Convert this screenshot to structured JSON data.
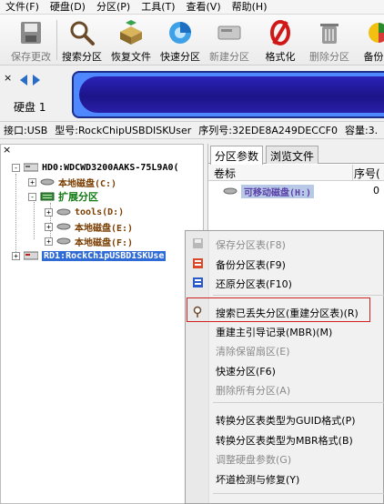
{
  "menu": [
    "文件(F)",
    "硬盘(D)",
    "分区(P)",
    "工具(T)",
    "查看(V)",
    "帮助(H)"
  ],
  "toolbar": {
    "save": "保存更改",
    "search": "搜索分区",
    "recover": "恢复文件",
    "quickpart": "快速分区",
    "newpart": "新建分区",
    "format": "格式化",
    "delete": "删除分区",
    "backup": "备份分"
  },
  "diskbar": {
    "close": "×",
    "label": "硬盘 1"
  },
  "info": {
    "iface": "接口:USB",
    "model": "型号:RockChipUSBDISKUser",
    "serial": "序列号:32EDE8A249DECCF0",
    "capacity": "容量:3."
  },
  "tree": {
    "close": "×",
    "hd0": "HD0:WDCWD3200AAKS-75L9A0(",
    "local_c": "本地磁盘(C:)",
    "extended": "扩展分区",
    "tools_d": "tools(D:)",
    "local_e": "本地磁盘(E:)",
    "local_f": "本地磁盘(F:)",
    "rd1": "RD1:RockChipUSBDISKUse"
  },
  "right": {
    "tab_params": "分区参数",
    "tab_browse": "浏览文件",
    "col_label": "卷标",
    "col_seq": "序号(",
    "row_name": "可移动磁盘(H:)",
    "row_seq": "0"
  },
  "context_menu": {
    "save_table": "保存分区表(F8)",
    "backup_table": "备份分区表(F9)",
    "restore_table": "还原分区表(F10)",
    "search_lost": "搜索已丢失分区(重建分区表)(R)",
    "rebuild_mbr": "重建主引导记录(MBR)(M)",
    "clear_reserved": "清除保留扇区(E)",
    "quick_partition": "快速分区(F6)",
    "delete_all": "删除所有分区(A)",
    "to_guid": "转换分区表类型为GUID格式(P)",
    "to_mbr": "转换分区表类型为MBR格式(B)",
    "adjust_params": "调整硬盘参数(G)",
    "bad_sector": "坏道检测与修复(Y)"
  }
}
